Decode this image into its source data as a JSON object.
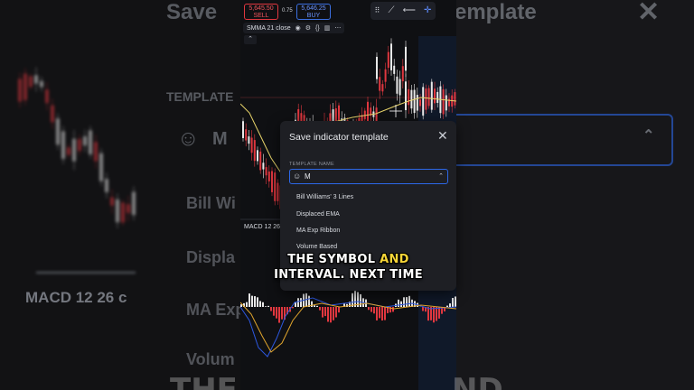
{
  "background": {
    "left_labels": [
      "MACD 12 26 c"
    ],
    "right_title": "Save",
    "right_title_suffix": "template",
    "right_field_label": "TEMPLATE",
    "right_field_value": "M",
    "right_items": [
      "Bill Wi",
      "Displa",
      "MA Exp",
      "Volum"
    ],
    "bottom_left": "THE",
    "bottom_right": "ND"
  },
  "trade": {
    "sell_price": "5,645.50",
    "sell_label": "SELL",
    "spread": "0.75",
    "buy_price": "5,646.25",
    "buy_label": "BUY"
  },
  "toolbar": {
    "icons": [
      "grip-icon",
      "trendline-icon",
      "horizontal-line-icon",
      "crosshair-icon"
    ]
  },
  "legend": {
    "label": "SMMA 21 close"
  },
  "macd": {
    "label": "MACD 12 26 c"
  },
  "dialog": {
    "title": "Save indicator template",
    "field_label": "TEMPLATE NAME",
    "field_value": "M",
    "items": [
      "Bill Williams' 3 Lines",
      "Displaced EMA",
      "MA Exp Ribbon",
      "Volume Based"
    ]
  },
  "caption": {
    "line1_a": "THE SYMBOL ",
    "line1_b": "AND",
    "line2": "INTERVAL. NEXT TIME"
  },
  "colors": {
    "up": "#e8e8e8",
    "down": "#e0373f",
    "smma": "#e7d36a",
    "accent": "#2d68e8"
  }
}
